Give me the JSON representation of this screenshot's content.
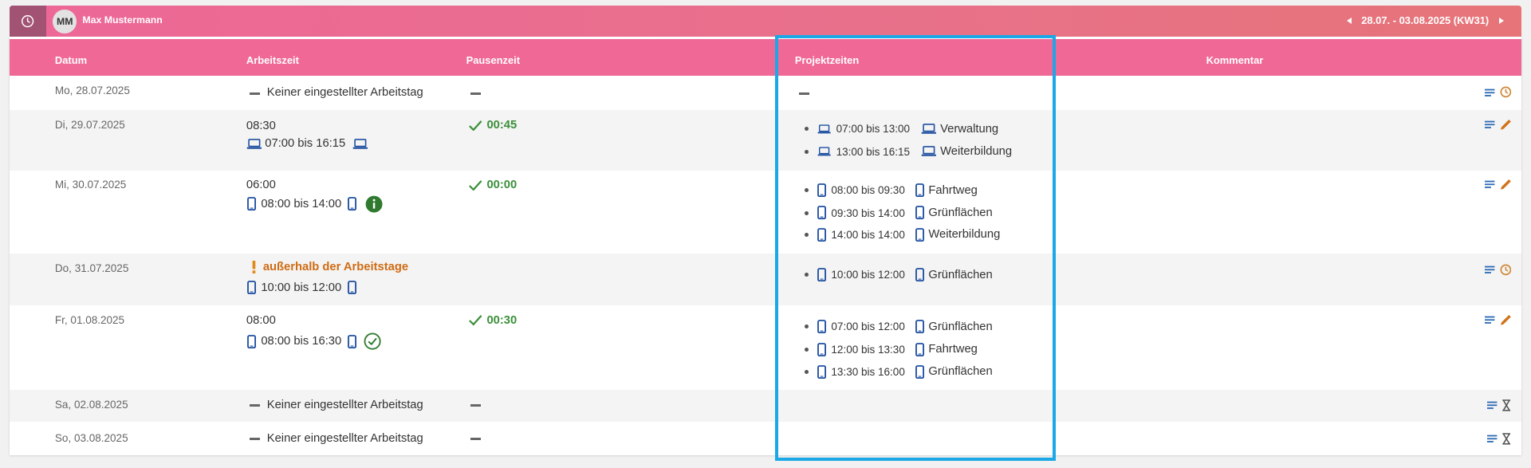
{
  "topbar": {
    "avatar_initials": "MM",
    "user_name": "Max Mustermann",
    "week_range": "28.07. - 03.08.2025 (KW31)"
  },
  "columns": {
    "datum": "Datum",
    "arbeitszeit": "Arbeitszeit",
    "pausenzeit": "Pausenzeit",
    "projektzeiten": "Projektzeiten",
    "kommentar": "Kommentar"
  },
  "colors": {
    "header_pink": "#f06896",
    "pause_green": "#3a8f3a",
    "warning_orange": "#cf6c14",
    "device_blue": "#1f4fa0",
    "highlight_blue": "#1aa8e6"
  },
  "days": [
    {
      "date": "Mo, 28.07.2025",
      "work_text": "Keiner eingestellter Arbeitstag",
      "action_icons": [
        "notes-icon",
        "clock-icon"
      ]
    },
    {
      "date": "Di, 29.07.2025",
      "work_hours": "08:30",
      "work_range": "07:00 bis 16:15",
      "device": "laptop-icon",
      "pause": "00:45",
      "projects": [
        {
          "time": "07:00 bis 13:00",
          "name": "Verwaltung",
          "device": "laptop-icon"
        },
        {
          "time": "13:00 bis 16:15",
          "name": "Weiterbildung",
          "device": "laptop-icon"
        }
      ],
      "action_icons": [
        "notes-icon",
        "pencil-icon"
      ]
    },
    {
      "date": "Mi, 30.07.2025",
      "work_hours": "06:00",
      "work_range": "08:00 bis 14:00",
      "device": "phone-icon",
      "status_icon": "info-icon",
      "pause": "00:00",
      "projects": [
        {
          "time": "08:00 bis 09:30",
          "name": "Fahrtweg",
          "device": "phone-icon"
        },
        {
          "time": "09:30 bis 14:00",
          "name": "Grünflächen",
          "device": "phone-icon"
        },
        {
          "time": "14:00 bis 14:00",
          "name": "Weiterbildung",
          "device": "phone-icon"
        }
      ],
      "action_icons": [
        "notes-icon",
        "pencil-icon"
      ]
    },
    {
      "date": "Do, 31.07.2025",
      "warning": "außerhalb der Arbeitstage",
      "work_range": "10:00 bis 12:00",
      "device": "phone-icon",
      "projects": [
        {
          "time": "10:00 bis 12:00",
          "name": "Grünflächen",
          "device": "phone-icon"
        }
      ],
      "action_icons": [
        "notes-icon",
        "clock-icon"
      ]
    },
    {
      "date": "Fr, 01.08.2025",
      "work_hours": "08:00",
      "work_range": "08:00 bis 16:30",
      "device": "phone-icon",
      "status_icon": "check-circle-icon",
      "pause": "00:30",
      "projects": [
        {
          "time": "07:00 bis 12:00",
          "name": "Grünflächen",
          "device": "phone-icon"
        },
        {
          "time": "12:00 bis 13:30",
          "name": "Fahrtweg",
          "device": "phone-icon"
        },
        {
          "time": "13:30 bis 16:00",
          "name": "Grünflächen",
          "device": "phone-icon"
        }
      ],
      "action_icons": [
        "notes-icon",
        "pencil-icon"
      ]
    },
    {
      "date": "Sa, 02.08.2025",
      "work_text": "Keiner eingestellter Arbeitstag",
      "action_icons": [
        "notes-icon",
        "hourglass-icon"
      ]
    },
    {
      "date": "So, 03.08.2025",
      "work_text": "Keiner eingestellter Arbeitstag",
      "action_icons": [
        "notes-icon",
        "hourglass-icon"
      ]
    }
  ]
}
